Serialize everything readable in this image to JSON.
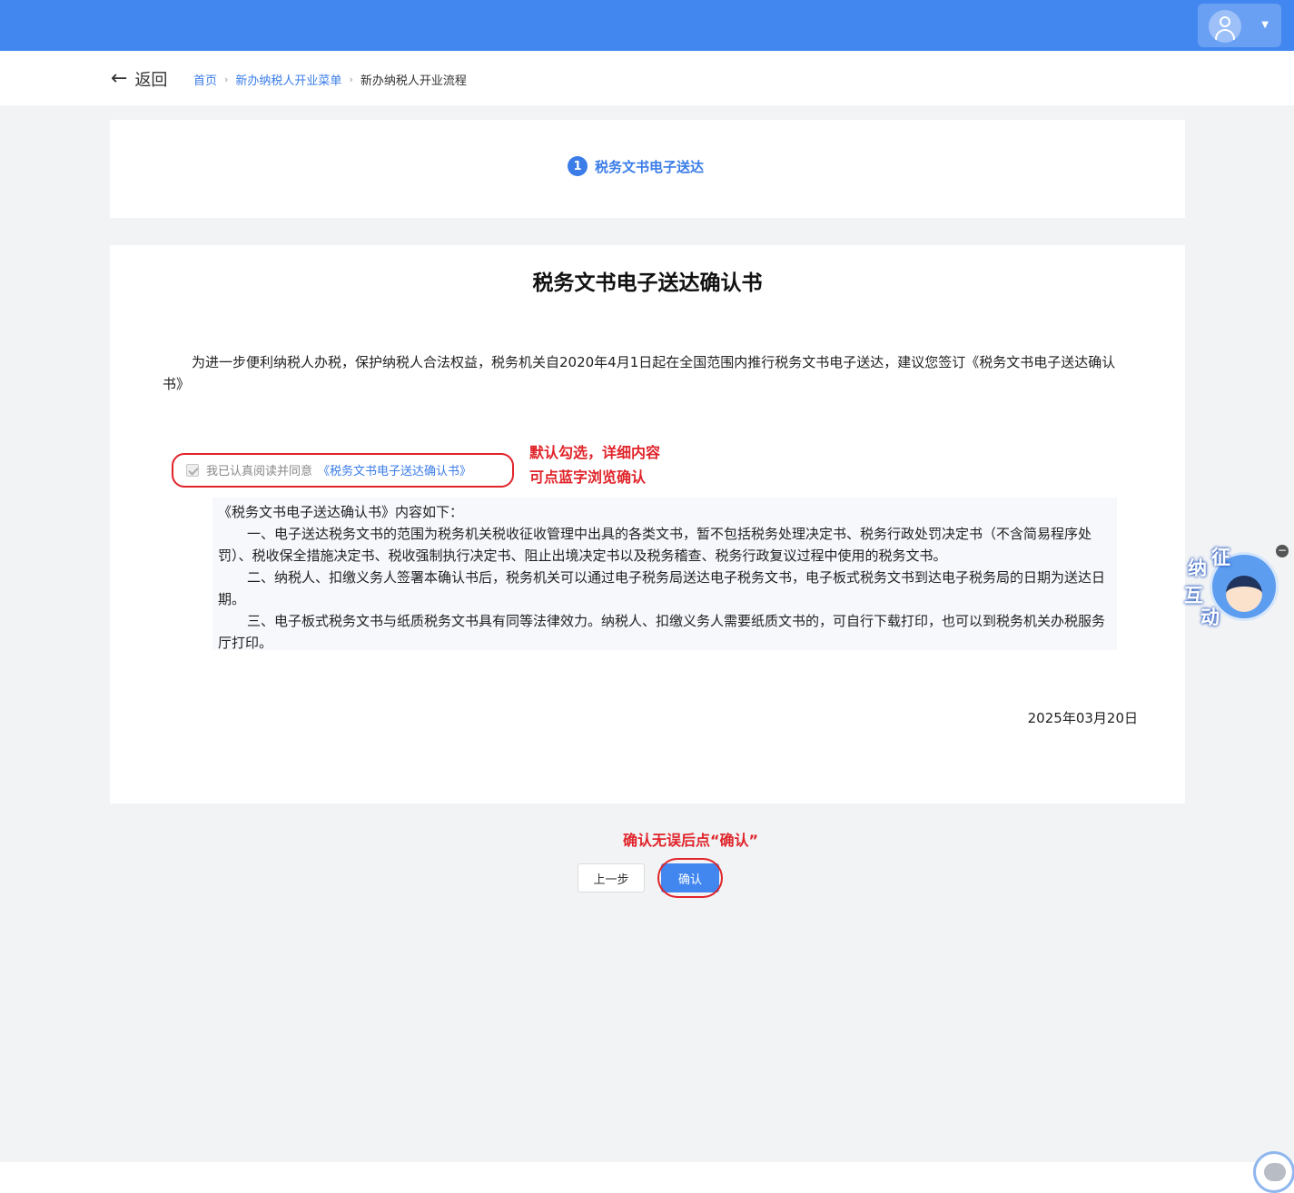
{
  "header": {
    "user_menu": {
      "avatar_icon": "user-avatar-icon",
      "caret_icon": "caret-down-icon"
    }
  },
  "nav": {
    "back_label": "返回",
    "breadcrumb": [
      "首页",
      "新办纳税人开业菜单",
      "新办纳税人开业流程"
    ]
  },
  "steps": [
    {
      "number": "1",
      "label": "税务文书电子送达"
    }
  ],
  "document": {
    "title": "税务文书电子送达确认书",
    "intro": "为进一步便利纳税人办税，保护纳税人合法权益，税务机关自2020年4月1日起在全国范围内推行税务文书电子送达，建议您签订《税务文书电子送达确认书》",
    "agree_text": "我已认真阅读并同意",
    "agree_link": "《税务文书电子送达确认书》",
    "agree_checked": true,
    "content_heading": "《税务文书电子送达确认书》内容如下：",
    "content_paragraphs": [
      "一、电子送达税务文书的范围为税务机关税收征收管理中出具的各类文书，暂不包括税务处理决定书、税务行政处罚决定书（不含简易程序处罚）、税收保全措施决定书、税收强制执行决定书、阻止出境决定书以及税务稽查、税务行政复议过程中使用的税务文书。",
      "二、纳税人、扣缴义务人签署本确认书后，税务机关可以通过电子税务局送达电子税务文书，电子板式税务文书到达电子税务局的日期为送达日期。",
      "三、电子板式税务文书与纸质税务文书具有同等法律效力。纳税人、扣缴义务人需要纸质文书的，可自行下载打印，也可以到税务机关办税服务厅打印。"
    ],
    "date": "2025年03月20日"
  },
  "actions": {
    "prev_label": "上一步",
    "confirm_label": "确认"
  },
  "annotations": {
    "checkbox_note_line1": "默认勾选，详细内容",
    "checkbox_note_line2": "可点蓝字浏览确认",
    "confirm_note": "确认无误后点“确认”"
  },
  "float_widget": {
    "chars": [
      "纳",
      "征",
      "互",
      "动"
    ],
    "close_icon": "close-icon"
  },
  "colors": {
    "primary": "#4287ef",
    "link": "#3a7ce8",
    "annotation": "#e0242a"
  }
}
